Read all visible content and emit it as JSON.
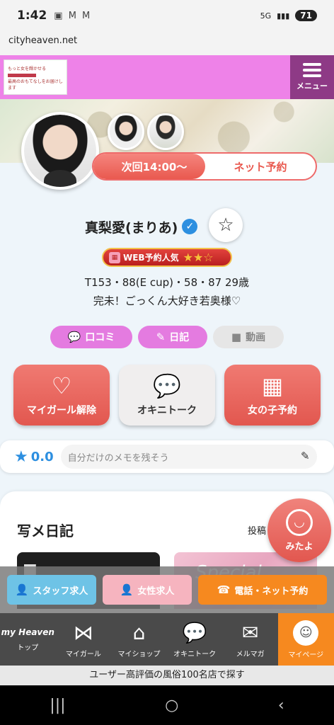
{
  "status_bar": {
    "time": "1:42",
    "notif_icons": "▣ M M",
    "network": "5G",
    "signal": "▮▮▮",
    "battery": "71"
  },
  "browser": {
    "url": "cityheaven.net"
  },
  "header": {
    "logo_line1": "もっと女を輝かせる",
    "logo_line2": "最高のおもてなしをお届けします",
    "menu_label": "メニュー"
  },
  "profile": {
    "next_time": "次回14:00〜",
    "net_reserve": "ネット予約",
    "name": "真梨愛(まりあ)",
    "web_badge_label": "WEB予約人気",
    "web_badge_stars": "★★☆",
    "spec": "T153・88(E cup)・58・87  29歳",
    "catchphrase": "完未！ごっくん大好き若奥様♡"
  },
  "chips": {
    "review": "口コミ",
    "diary": "日記",
    "video": "動画"
  },
  "actions": {
    "mygirl": "マイガール解除",
    "okini": "オキニトーク",
    "reserve": "女の子予約"
  },
  "memo": {
    "score": "0.0",
    "placeholder": "自分だけのメモを残そう"
  },
  "diary": {
    "title": "写メ日記",
    "more": "投稿",
    "thumb2_text": "Special"
  },
  "mitayo": {
    "label": "みたよ"
  },
  "recruit": {
    "staff": "スタッフ求人",
    "female": "女性求人",
    "tel": "電話・ネット予約"
  },
  "tabs": [
    {
      "label": "トップ",
      "logo": "my Heaven"
    },
    {
      "label": "マイガール"
    },
    {
      "label": "マイショップ"
    },
    {
      "label": "オキニトーク"
    },
    {
      "label": "メルマガ"
    },
    {
      "label": "マイページ"
    }
  ],
  "promo": {
    "text": "ユーザー高評価の風俗100名店で探す"
  },
  "colors": {
    "header": "#ee82e8",
    "menu": "#8e3a86",
    "accent": "#e2574f",
    "active_tab": "#f6891f",
    "star": "#2d8fe0"
  },
  "icons": {
    "menu": "hamburger-icon",
    "verified": "verified-icon",
    "favorite": "star-outline-icon",
    "review": "chat-bubble-icon",
    "diary": "edit-icon",
    "video": "video-camera-icon",
    "mygirl": "heart-icon",
    "okini": "speech-bubbles-icon",
    "reserve": "calendar-icon",
    "memo": "pencil-icon",
    "mitayo": "smile-icon",
    "staff": "person-icon",
    "female": "person-icon",
    "tel": "phone-icon",
    "tab_mygirl": "ribbon-icon",
    "tab_myshop": "shop-icon",
    "tab_okini": "chat-icon",
    "tab_mail": "mail-icon",
    "tab_mypage": "user-avatar-icon"
  }
}
